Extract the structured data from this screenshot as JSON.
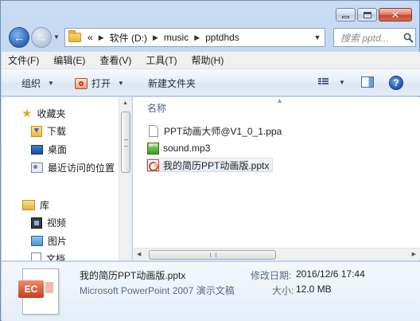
{
  "address": {
    "overflow": "«",
    "crumbs": [
      "软件 (D:)",
      "music",
      "pptdhds"
    ]
  },
  "search": {
    "placeholder": "搜索 pptd..."
  },
  "menubar": [
    "文件(F)",
    "编辑(E)",
    "查看(V)",
    "工具(T)",
    "帮助(H)"
  ],
  "toolbar": {
    "organize": "组织",
    "open": "打开",
    "new_folder": "新建文件夹"
  },
  "nav_pane": {
    "favorites": "收藏夹",
    "favorites_items": [
      "下载",
      "桌面",
      "最近访问的位置"
    ],
    "libraries": "库",
    "libraries_items": [
      "视频",
      "图片",
      "文档"
    ]
  },
  "content": {
    "column_name": "名称",
    "files": [
      {
        "name": "PPT动画大师@V1_0_1.ppa",
        "icon": "document-icon"
      },
      {
        "name": "sound.mp3",
        "icon": "mp3-icon"
      },
      {
        "name": "我的简历PPT动画版.pptx",
        "icon": "pptx-icon",
        "selected": true
      }
    ],
    "mp3_badge": "MP3"
  },
  "details": {
    "name": "我的简历PPT动画版.pptx",
    "type": "Microsoft PowerPoint 2007 演示文稿",
    "modified_label": "修改日期:",
    "modified_value": "2016/12/6 17:44",
    "size_label": "大小:",
    "size_value": "12.0 MB",
    "icon_badge": "EC"
  },
  "colors": {
    "accent": "#2a63b8",
    "selection_border": "#d2dceb",
    "pptx_red": "#d24726"
  }
}
